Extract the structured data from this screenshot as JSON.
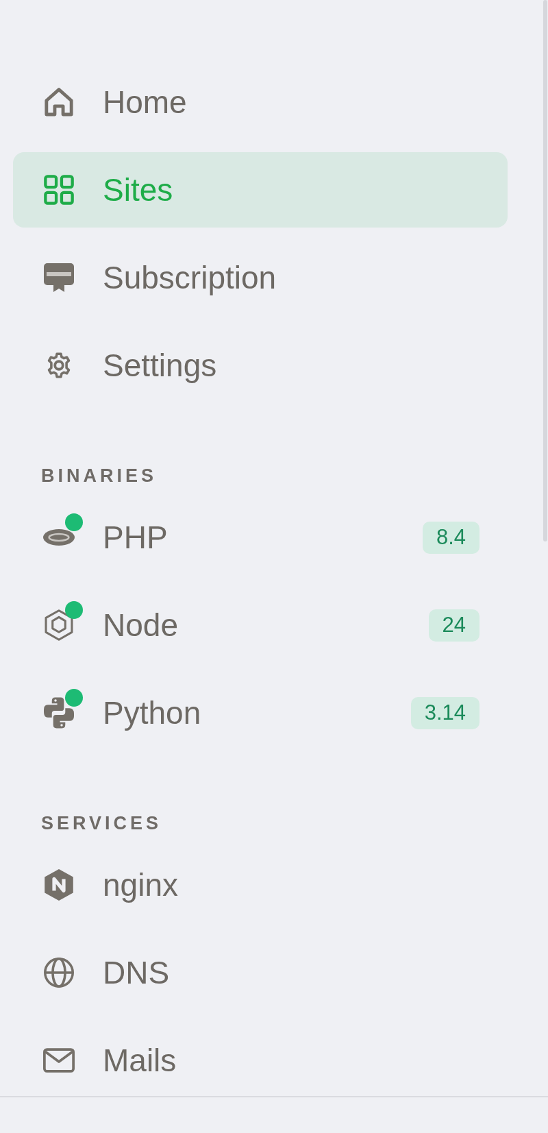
{
  "nav": [
    {
      "label": "Home",
      "selected": false
    },
    {
      "label": "Sites",
      "selected": true
    },
    {
      "label": "Subscription",
      "selected": false
    },
    {
      "label": "Settings",
      "selected": false
    }
  ],
  "binaries": {
    "title": "BINARIES",
    "items": [
      {
        "label": "PHP",
        "running": true,
        "version": "8.4"
      },
      {
        "label": "Node",
        "running": true,
        "version": "24"
      },
      {
        "label": "Python",
        "running": true,
        "version": "3.14"
      }
    ]
  },
  "services": {
    "title": "SERVICES",
    "items": [
      {
        "label": "nginx"
      },
      {
        "label": "DNS"
      },
      {
        "label": "Mails"
      }
    ]
  }
}
